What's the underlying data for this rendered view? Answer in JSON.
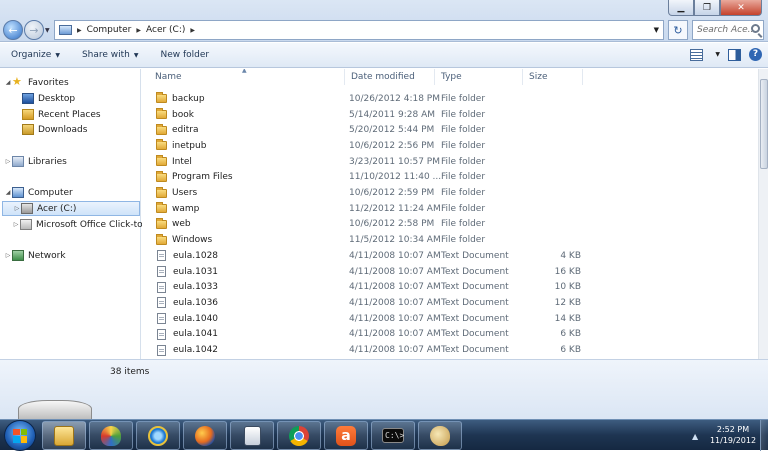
{
  "window": {
    "controls": {
      "minimize": "▁",
      "restore": "❐",
      "close": "✕"
    }
  },
  "address": {
    "crumbs": [
      "Computer",
      "Acer (C:)"
    ],
    "search_placeholder": "Search Ace..."
  },
  "toolbar": {
    "organize": "Organize",
    "share_with": "Share with",
    "new_folder": "New folder"
  },
  "nav": {
    "favorites": "Favorites",
    "desktop": "Desktop",
    "recent_places": "Recent Places",
    "downloads": "Downloads",
    "libraries": "Libraries",
    "computer": "Computer",
    "acer": "Acer (C:)",
    "office": "Microsoft Office Click-to-",
    "network": "Network"
  },
  "columns": {
    "name": "Name",
    "date": "Date modified",
    "type": "Type",
    "size": "Size"
  },
  "files": [
    {
      "name": "backup",
      "date": "10/26/2012 4:18 PM",
      "type": "File folder",
      "size": "",
      "icon": "folder-icon"
    },
    {
      "name": "book",
      "date": "5/14/2011 9:28 AM",
      "type": "File folder",
      "size": "",
      "icon": "folder-icon"
    },
    {
      "name": "editra",
      "date": "5/20/2012 5:44 PM",
      "type": "File folder",
      "size": "",
      "icon": "folder-icon"
    },
    {
      "name": "inetpub",
      "date": "10/6/2012 2:56 PM",
      "type": "File folder",
      "size": "",
      "icon": "folder-icon"
    },
    {
      "name": "Intel",
      "date": "3/23/2011 10:57 PM",
      "type": "File folder",
      "size": "",
      "icon": "folder-icon"
    },
    {
      "name": "Program Files",
      "date": "11/10/2012 11:40 ...",
      "type": "File folder",
      "size": "",
      "icon": "folder-icon"
    },
    {
      "name": "Users",
      "date": "10/6/2012 2:59 PM",
      "type": "File folder",
      "size": "",
      "icon": "folder-icon"
    },
    {
      "name": "wamp",
      "date": "11/2/2012 11:24 AM",
      "type": "File folder",
      "size": "",
      "icon": "folder-icon"
    },
    {
      "name": "web",
      "date": "10/6/2012 2:58 PM",
      "type": "File folder",
      "size": "",
      "icon": "folder-icon"
    },
    {
      "name": "Windows",
      "date": "11/5/2012 10:34 AM",
      "type": "File folder",
      "size": "",
      "icon": "folder-icon"
    },
    {
      "name": "eula.1028",
      "date": "4/11/2008 10:07 AM",
      "type": "Text Document",
      "size": "4 KB",
      "icon": "document-icon"
    },
    {
      "name": "eula.1031",
      "date": "4/11/2008 10:07 AM",
      "type": "Text Document",
      "size": "16 KB",
      "icon": "document-icon"
    },
    {
      "name": "eula.1033",
      "date": "4/11/2008 10:07 AM",
      "type": "Text Document",
      "size": "10 KB",
      "icon": "document-icon"
    },
    {
      "name": "eula.1036",
      "date": "4/11/2008 10:07 AM",
      "type": "Text Document",
      "size": "12 KB",
      "icon": "document-icon"
    },
    {
      "name": "eula.1040",
      "date": "4/11/2008 10:07 AM",
      "type": "Text Document",
      "size": "14 KB",
      "icon": "document-icon"
    },
    {
      "name": "eula.1041",
      "date": "4/11/2008 10:07 AM",
      "type": "Text Document",
      "size": "6 KB",
      "icon": "document-icon"
    },
    {
      "name": "eula.1042",
      "date": "4/11/2008 10:07 AM",
      "type": "Text Document",
      "size": "6 KB",
      "icon": "document-icon"
    }
  ],
  "status": {
    "item_count": "38 items"
  },
  "taskbar": {
    "apps": [
      "windows-explorer",
      "paint",
      "internet-explorer",
      "firefox",
      "notepad",
      "chrome",
      "avast",
      "command-prompt",
      "paint-brush"
    ],
    "time": "2:52 PM",
    "date": "11/19/2012",
    "cmd_glyph": "C:\\>",
    "avast_glyph": "a"
  },
  "colors": {
    "accent": "#2f6fc5",
    "taskbar": "#1e3552",
    "selection": "#cfe3f9"
  }
}
